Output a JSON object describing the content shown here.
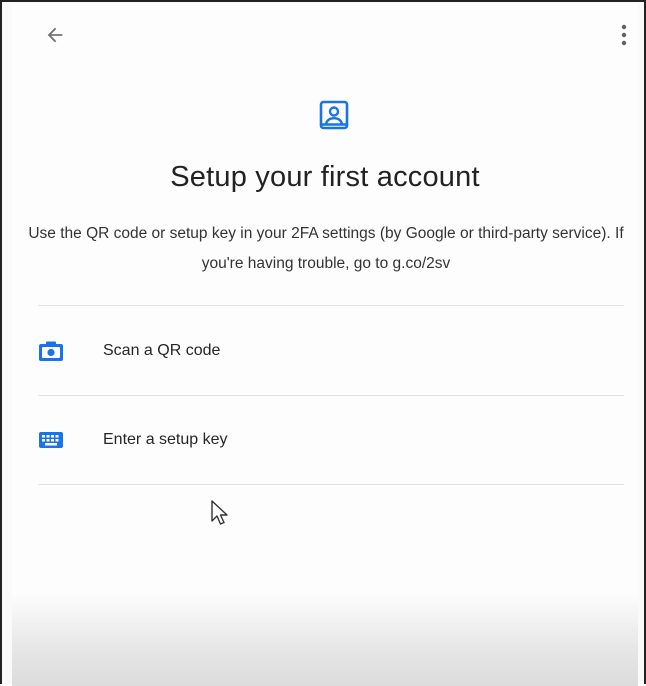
{
  "header": {
    "back_icon": "arrow-back-icon",
    "menu_icon": "more-vert-icon"
  },
  "hero": {
    "icon": "account-box-icon",
    "accent_color": "#1a73e8",
    "title": "Setup your first account",
    "description": "Use the QR code or setup key in your 2FA settings (by Google or third-party service). If you're having trouble, go to g.co/2sv"
  },
  "options": [
    {
      "icon": "camera-icon",
      "label": "Scan a QR code"
    },
    {
      "icon": "keyboard-icon",
      "label": "Enter a setup key"
    }
  ]
}
